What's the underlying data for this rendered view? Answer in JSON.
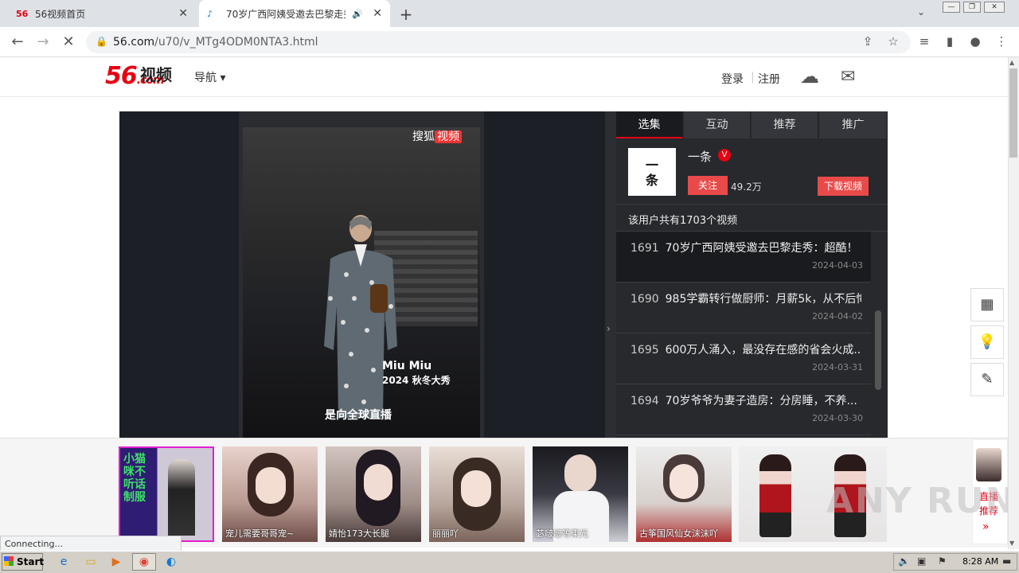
{
  "browser": {
    "tabs": [
      {
        "favicon": "56",
        "title": "56视频首页"
      },
      {
        "favicon": "♪",
        "title": "70岁广西阿姨受邀去巴黎走秀"
      }
    ],
    "url_host": "56.com",
    "url_path": "/u70/v_MTg4ODM0NTA3.html",
    "status_text": "Connecting..."
  },
  "header": {
    "logo_num": "56",
    "logo_domain": ".com",
    "logo_cn": "视频",
    "nav_label": "导航 ▾",
    "login": "登录",
    "register": "注册",
    "separator": "|"
  },
  "player": {
    "watermark": "搜狐",
    "watermark_tag": "视频",
    "brand_line1": "Miu Miu",
    "brand_line2": "2024 秋冬大秀",
    "subtitle": "是向全球直播"
  },
  "panel": {
    "tabs": [
      "选集",
      "互动",
      "推荐",
      "推广"
    ],
    "uploader": {
      "avatar_text_1": "一",
      "avatar_text_2": "条",
      "name": "一条",
      "verified_mark": "V",
      "follow_label": "关注",
      "followers": "49.2万",
      "download_label": "下载视频"
    },
    "video_count_text": "该用户共有1703个视频",
    "episodes": [
      {
        "num": "1691",
        "title": "70岁广西阿姨受邀去巴黎走秀：超酷！",
        "date": "2024-04-03"
      },
      {
        "num": "1690",
        "title": "985学霸转行做厨师：月薪5k，从不后悔",
        "date": "2024-04-02"
      },
      {
        "num": "1695",
        "title": "600万人涌入，最没存在感的省会火成...",
        "date": "2024-03-31"
      },
      {
        "num": "1694",
        "title": "70岁爷爷为妻子造房：分房睡，不养...",
        "date": "2024-03-30"
      }
    ]
  },
  "live": {
    "thumbs": [
      {
        "caption": ""
      },
      {
        "caption": "宠儿需要哥哥宠~"
      },
      {
        "caption": "婧怡173大长腿"
      },
      {
        "caption": "丽丽吖"
      },
      {
        "caption": "苾啵啵等東光"
      },
      {
        "caption": "古筝国风仙女沫沫吖"
      },
      {
        "caption": ""
      }
    ],
    "promo_text": "小猫咪不听话 制服",
    "side_label_1": "直播",
    "side_label_2": "推荐",
    "side_arrow": "»"
  },
  "taskbar": {
    "start_label": "Start",
    "clock": "8:28 AM"
  },
  "watermark_text": "ANY RUN"
}
